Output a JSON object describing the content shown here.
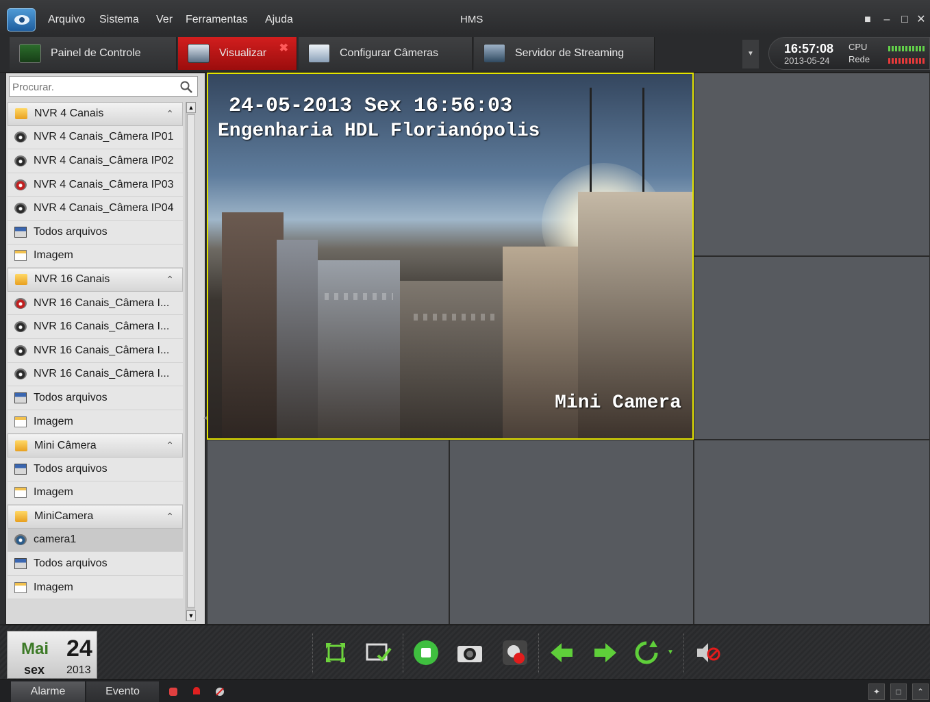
{
  "window": {
    "title": "HMS",
    "menu": [
      "Arquivo",
      "Sistema",
      "Ver",
      "Ferramentas",
      "Ajuda"
    ]
  },
  "tabs": [
    {
      "label": "Painel de Controle",
      "icon": "dashboard-icon"
    },
    {
      "label": "Visualizar",
      "icon": "monitor-icon",
      "active": true
    },
    {
      "label": "Configurar Câmeras",
      "icon": "camera-config-icon"
    },
    {
      "label": "Servidor de Streaming",
      "icon": "server-icon"
    }
  ],
  "status": {
    "time": "16:57:08",
    "date": "2013-05-24",
    "cpu_label": "CPU",
    "net_label": "Rede",
    "colors": {
      "cpu": "#63d24a",
      "net": "#e83a3a"
    }
  },
  "search": {
    "placeholder": "Procurar."
  },
  "tree": [
    {
      "type": "group",
      "label": "NVR 4 Canais"
    },
    {
      "type": "camera",
      "label": "NVR 4 Canais_Câmera IP01",
      "state": "normal"
    },
    {
      "type": "camera",
      "label": "NVR 4 Canais_Câmera IP02",
      "state": "normal"
    },
    {
      "type": "camera",
      "label": "NVR 4 Canais_Câmera IP03",
      "state": "recording"
    },
    {
      "type": "camera",
      "label": "NVR 4 Canais_Câmera IP04",
      "state": "normal"
    },
    {
      "type": "files",
      "label": "Todos arquivos"
    },
    {
      "type": "image",
      "label": "Imagem"
    },
    {
      "type": "group",
      "label": "NVR 16 Canais"
    },
    {
      "type": "camera",
      "label": "NVR 16 Canais_Câmera I...",
      "state": "recording"
    },
    {
      "type": "camera",
      "label": "NVR 16 Canais_Câmera I...",
      "state": "normal"
    },
    {
      "type": "camera",
      "label": "NVR 16 Canais_Câmera I...",
      "state": "normal"
    },
    {
      "type": "camera",
      "label": "NVR 16 Canais_Câmera I...",
      "state": "normal"
    },
    {
      "type": "files",
      "label": "Todos arquivos"
    },
    {
      "type": "image",
      "label": "Imagem"
    },
    {
      "type": "group",
      "label": "Mini Câmera"
    },
    {
      "type": "files",
      "label": "Todos arquivos"
    },
    {
      "type": "image",
      "label": "Imagem"
    },
    {
      "type": "group",
      "label": "MiniCamera"
    },
    {
      "type": "camera",
      "label": "camera1",
      "state": "live",
      "selected": true
    },
    {
      "type": "files",
      "label": "Todos arquivos"
    },
    {
      "type": "image",
      "label": "Imagem"
    }
  ],
  "video": {
    "osd_datetime": "24-05-2013 Sex 16:56:03",
    "osd_location": "Engenharia HDL Florianópolis",
    "osd_camera": "Mini Camera",
    "accent": "#e4e400"
  },
  "calendar": {
    "month": "Mai",
    "day": "24",
    "weekday": "sex",
    "year": "2013"
  },
  "toolbar_icons": [
    "fullscreen-icon",
    "layout-icon",
    "stop-all-icon",
    "snapshot-icon",
    "record-icon",
    "previous-icon",
    "next-icon",
    "cycle-icon",
    "mute-icon"
  ],
  "statusbar": {
    "tabs": [
      "Alarme",
      "Evento"
    ]
  }
}
